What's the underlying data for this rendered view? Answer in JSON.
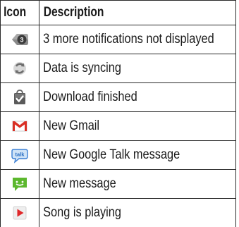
{
  "table": {
    "headers": [
      "Icon",
      "Description"
    ],
    "rows": [
      {
        "icon": "more-notifications-badge-icon",
        "badge": "3",
        "description": "3 more notifications not displayed"
      },
      {
        "icon": "sync-arrows-icon",
        "description": "Data is syncing"
      },
      {
        "icon": "download-finished-bag-icon",
        "description": "Download finished"
      },
      {
        "icon": "gmail-envelope-icon",
        "description": "New Gmail"
      },
      {
        "icon": "google-talk-bubble-icon",
        "badge": "talk",
        "description": "New Google Talk message"
      },
      {
        "icon": "message-bubble-icon",
        "description": "New message"
      },
      {
        "icon": "play-icon",
        "description": "Song is playing"
      }
    ]
  },
  "colors": {
    "gmail_red": "#d93025",
    "talk_blue": "#3b7fd4",
    "message_green": "#5cb82e",
    "play_red": "#e0282a",
    "icon_gray": "#7a7a7a"
  }
}
